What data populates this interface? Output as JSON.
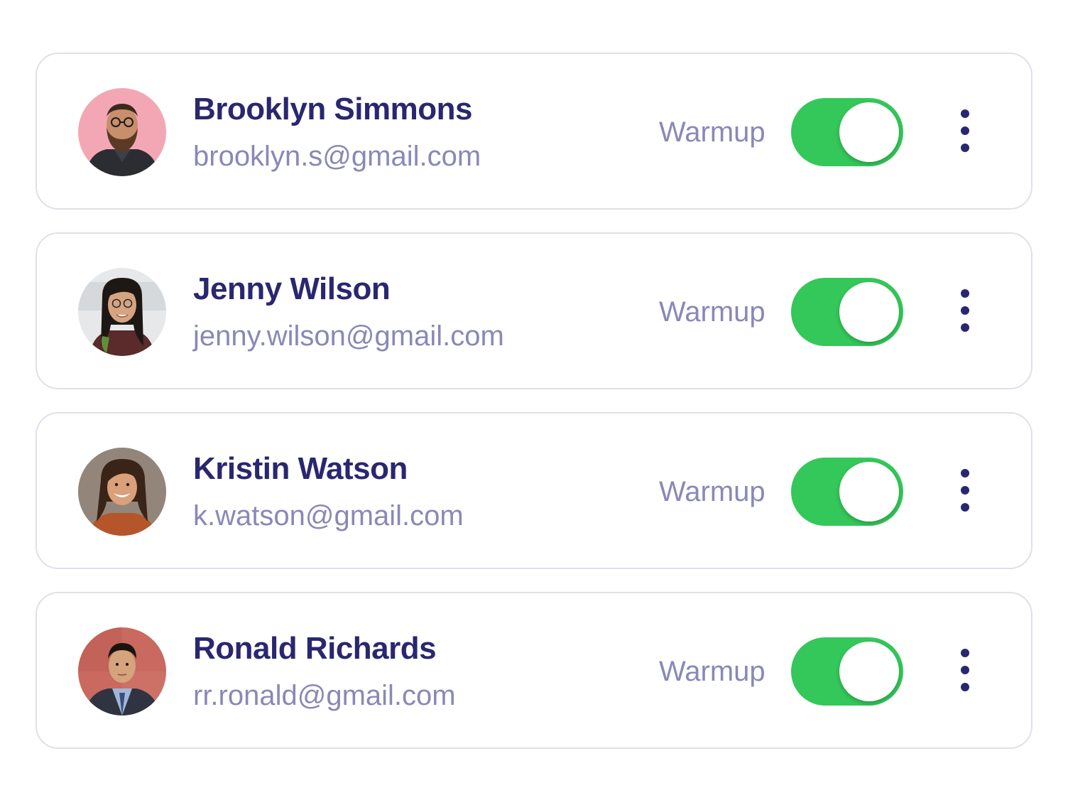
{
  "accounts": [
    {
      "name": "Brooklyn Simmons",
      "email": "brooklyn.s@gmail.com",
      "toggle_label": "Warmup",
      "warmup_enabled": true
    },
    {
      "name": "Jenny Wilson",
      "email": "jenny.wilson@gmail.com",
      "toggle_label": "Warmup",
      "warmup_enabled": true
    },
    {
      "name": "Kristin Watson",
      "email": "k.watson@gmail.com",
      "toggle_label": "Warmup",
      "warmup_enabled": true
    },
    {
      "name": "Ronald Richards",
      "email": "rr.ronald@gmail.com",
      "toggle_label": "Warmup",
      "warmup_enabled": true
    }
  ],
  "icons": {
    "menu": "more-vertical-icon"
  },
  "colors": {
    "name_text": "#2a2770",
    "secondary_text": "#8a88b8",
    "toggle_on": "#34c759",
    "card_border": "#dfe0ea"
  }
}
